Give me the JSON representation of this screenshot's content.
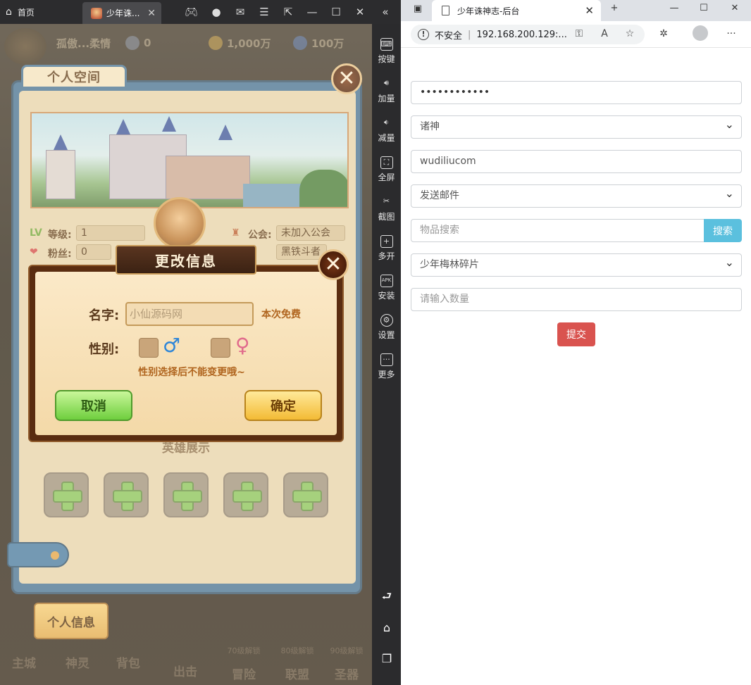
{
  "emulator": {
    "home_tab": "首页",
    "game_tab": "少年诛...",
    "sidebar": [
      {
        "label": "按键",
        "icon": "keyboard-icon"
      },
      {
        "label": "加量",
        "icon": "volume-up-icon"
      },
      {
        "label": "减量",
        "icon": "volume-down-icon"
      },
      {
        "label": "全屏",
        "icon": "fullscreen-icon"
      },
      {
        "label": "截图",
        "icon": "scissors-icon"
      },
      {
        "label": "多开",
        "icon": "multi-instance-icon"
      },
      {
        "label": "安装",
        "icon": "apk-icon"
      },
      {
        "label": "设置",
        "icon": "gear-icon"
      },
      {
        "label": "更多",
        "icon": "more-icon"
      }
    ]
  },
  "game": {
    "top_bar": {
      "player_name": "孤傲...柔情",
      "pvp_count": "0",
      "gold": "1,000万",
      "gems": "100万"
    },
    "personal_space": {
      "tab_title": "个人空间",
      "level_label": "等级:",
      "level_value": "1",
      "fans_label": "粉丝:",
      "fans_value": "0",
      "guild_label": "公会:",
      "guild_value": "未加入公会",
      "rank_value": "黑铁斗者",
      "hero_section_title": "英雄展示",
      "bookmark_label": "个人信息"
    },
    "modal": {
      "title": "更改信息",
      "name_label": "名字:",
      "name_placeholder": "小仙源码网",
      "free_note": "本次免费",
      "gender_label": "性别:",
      "male_symbol": "♂",
      "female_symbol": "♀",
      "gender_note": "性别选择后不能变更哦~",
      "cancel_label": "取消",
      "confirm_label": "确定"
    },
    "bottom_nav": [
      {
        "label": "主城",
        "lock": ""
      },
      {
        "label": "神灵",
        "lock": ""
      },
      {
        "label": "背包",
        "lock": ""
      },
      {
        "label": "出击",
        "lock": ""
      },
      {
        "label": "冒险",
        "lock": "70级解锁"
      },
      {
        "label": "联盟",
        "lock": "80级解锁"
      },
      {
        "label": "圣器",
        "lock": "90级解锁"
      }
    ]
  },
  "browser": {
    "tab_title": "少年诛神志-后台",
    "security_label": "不安全",
    "url": "192.168.200.129:...",
    "form": {
      "password_value": "••••••••••••",
      "server_select": "诸神",
      "account_value": "wudiliucom",
      "action_select": "发送邮件",
      "item_search_placeholder": "物品搜索",
      "search_label": "搜索",
      "item_select": "少年梅林碎片",
      "quantity_placeholder": "请输入数量",
      "submit_label": "提交"
    }
  },
  "colors": {
    "search_button": "#5bc0de",
    "submit_button": "#d9534f",
    "panel_blue": "#3f6f9a"
  }
}
